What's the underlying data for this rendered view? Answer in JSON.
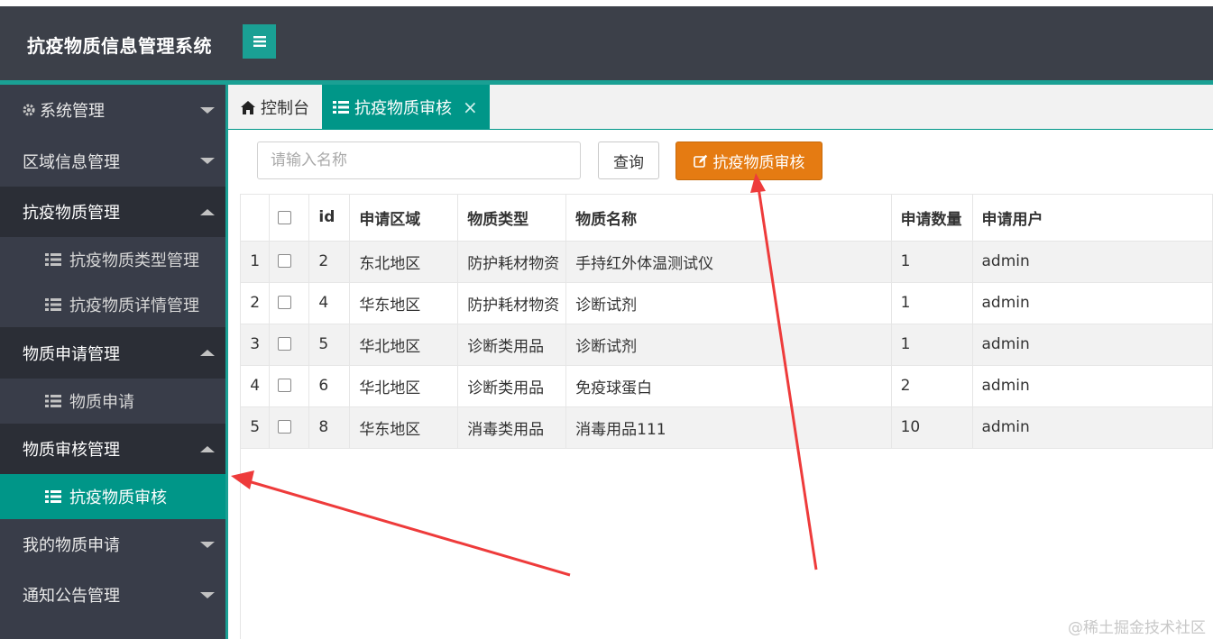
{
  "app": {
    "title": "抗疫物质信息管理系统"
  },
  "sidebar": {
    "items": [
      {
        "label": "系统管理",
        "icon": "gear-icon",
        "state": "collapsed"
      },
      {
        "label": "区域信息管理",
        "state": "collapsed"
      },
      {
        "label": "抗疫物质管理",
        "state": "expanded"
      },
      {
        "label": "抗疫物质类型管理",
        "icon": "list-icon",
        "sub": true
      },
      {
        "label": "抗疫物质详情管理",
        "icon": "list-icon",
        "sub": true
      },
      {
        "label": "物质申请管理",
        "state": "expanded"
      },
      {
        "label": "物质申请",
        "icon": "list-icon",
        "sub": true
      },
      {
        "label": "物质审核管理",
        "state": "expanded"
      },
      {
        "label": "抗疫物质审核",
        "icon": "list-icon",
        "sub": true,
        "active": true
      },
      {
        "label": "我的物质申请",
        "state": "collapsed"
      },
      {
        "label": "通知公告管理",
        "state": "collapsed"
      }
    ]
  },
  "tabs": {
    "home": {
      "label": "控制台",
      "icon": "home-icon"
    },
    "current": {
      "label": "抗疫物质审核",
      "icon": "list-icon",
      "close": "×"
    }
  },
  "toolbar": {
    "search_placeholder": "请输入名称",
    "query_label": "查询",
    "audit_label": "抗疫物质审核",
    "audit_icon": "edit-icon"
  },
  "table": {
    "columns": [
      "",
      "",
      "id",
      "申请区域",
      "物质类型",
      "物质名称",
      "申请数量",
      "申请用户"
    ],
    "rows": [
      {
        "no": "1",
        "id": "2",
        "region": "东北地区",
        "type": "防护耗材物资",
        "name": "手持红外体温测试仪",
        "qty": "1",
        "user": "admin"
      },
      {
        "no": "2",
        "id": "4",
        "region": "华东地区",
        "type": "防护耗材物资",
        "name": "诊断试剂",
        "qty": "1",
        "user": "admin"
      },
      {
        "no": "3",
        "id": "5",
        "region": "华北地区",
        "type": "诊断类用品",
        "name": "诊断试剂",
        "qty": "1",
        "user": "admin"
      },
      {
        "no": "4",
        "id": "6",
        "region": "华北地区",
        "type": "诊断类用品",
        "name": "免疫球蛋白",
        "qty": "2",
        "user": "admin"
      },
      {
        "no": "5",
        "id": "8",
        "region": "华东地区",
        "type": "消毒类用品",
        "name": "消毒用品111",
        "qty": "10",
        "user": "admin"
      }
    ]
  },
  "watermark": "@稀土掘金技术社区",
  "colors": {
    "header_bg": "#3c4049",
    "sidebar_bg": "#393d49",
    "accent": "#009688",
    "audit_button": "#e57b12",
    "annotation_arrow": "#ee3b3b"
  }
}
